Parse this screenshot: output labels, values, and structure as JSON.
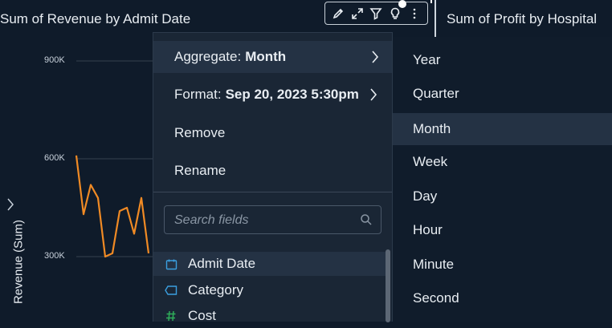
{
  "header": {
    "title": "Sum of Revenue by Admit Date",
    "right_title": "Sum of Profit by Hospital"
  },
  "toolbar": {
    "icons": [
      "pencil-icon",
      "expand-icon",
      "filter-icon",
      "lightbulb-icon",
      "more-vertical-icon"
    ]
  },
  "chart": {
    "ylabel": "Revenue (Sum)",
    "yticks": [
      "900K",
      "600K",
      "300K"
    ],
    "line_color": "#f08a24"
  },
  "chart_data": {
    "type": "line",
    "ylabel": "Revenue (Sum)",
    "yticks": [
      "900K",
      "600K",
      "300K"
    ],
    "series": [
      {
        "values": [
          610000,
          430000,
          520000,
          480000,
          300000,
          310000,
          440000,
          450000,
          370000,
          480000,
          310000
        ]
      }
    ]
  },
  "menu": {
    "items": [
      {
        "label": "Aggregate:",
        "value": "Month",
        "has_submenu": true
      },
      {
        "label": "Format:",
        "value": "Sep 20, 2023 5:30pm",
        "has_submenu": true
      },
      {
        "label": "Remove",
        "value": "",
        "has_submenu": false
      },
      {
        "label": "Rename",
        "value": "",
        "has_submenu": false
      }
    ],
    "search_placeholder": "Search fields",
    "fields": [
      {
        "label": "Admit Date",
        "icon": "calendar-icon"
      },
      {
        "label": "Category",
        "icon": "tag-icon"
      },
      {
        "label": "Cost",
        "icon": "hash-icon"
      }
    ]
  },
  "submenu": {
    "items": [
      "Year",
      "Quarter",
      "Month",
      "Week",
      "Day",
      "Hour",
      "Minute",
      "Second"
    ],
    "active": "Month"
  },
  "colors": {
    "background": "#0f1b2a",
    "menu_bg": "#1a2635",
    "highlight": "#243244",
    "accent_blue": "#3b9fe0",
    "accent_green": "#2fae5a",
    "line": "#f08a24"
  }
}
